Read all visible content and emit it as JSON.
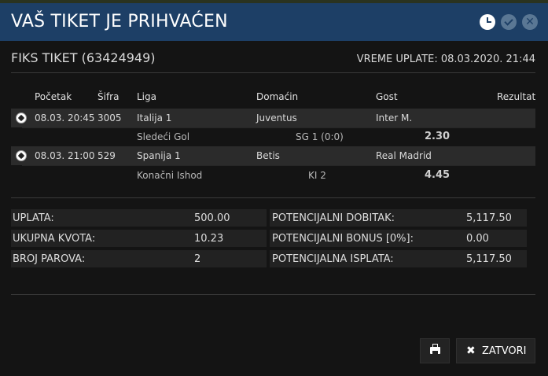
{
  "header": {
    "title": "VAŠ TIKET JE PRIHVAĆEN",
    "icons": [
      "clock-icon",
      "check-icon",
      "close-icon"
    ]
  },
  "ticket": {
    "title": "FIKS TIKET (63424949)",
    "time": "VREME UPLATE: 08.03.2020. 21:44"
  },
  "table": {
    "headers": {
      "start": "Početak",
      "code": "Šifra",
      "league": "Liga",
      "home": "Domaćin",
      "away": "Gost",
      "result": "Rezultat"
    },
    "matches": [
      {
        "start": "08.03. 20:45",
        "code": "3005",
        "league": "Italija 1",
        "home": "Juventus",
        "away": "Inter M.",
        "result": "",
        "bet_type": "Sledeći Gol",
        "bet": "SG 1 (0:0)",
        "odd": "2.30"
      },
      {
        "start": "08.03. 21:00",
        "code": "529",
        "league": "Spanija 1",
        "home": "Betis",
        "away": "Real Madrid",
        "result": "",
        "bet_type": "Konačni Ishod",
        "bet": "KI 2",
        "odd": "4.45"
      }
    ]
  },
  "summary": {
    "left": [
      {
        "label": "UPLATA:",
        "value": "500.00"
      },
      {
        "label": "UKUPNA KVOTA:",
        "value": "10.23"
      },
      {
        "label": "BROJ PAROVA:",
        "value": "2"
      }
    ],
    "right": [
      {
        "label": "POTENCIJALNI DOBITAK:",
        "value": "5,117.50"
      },
      {
        "label": "POTENCIJALNI BONUS [0%]:",
        "value": "0.00"
      },
      {
        "label": "POTENCIJALNA ISPLATA:",
        "value": "5,117.50"
      }
    ]
  },
  "buttons": {
    "close": "ZATVORI",
    "print_icon": "printer-icon"
  }
}
